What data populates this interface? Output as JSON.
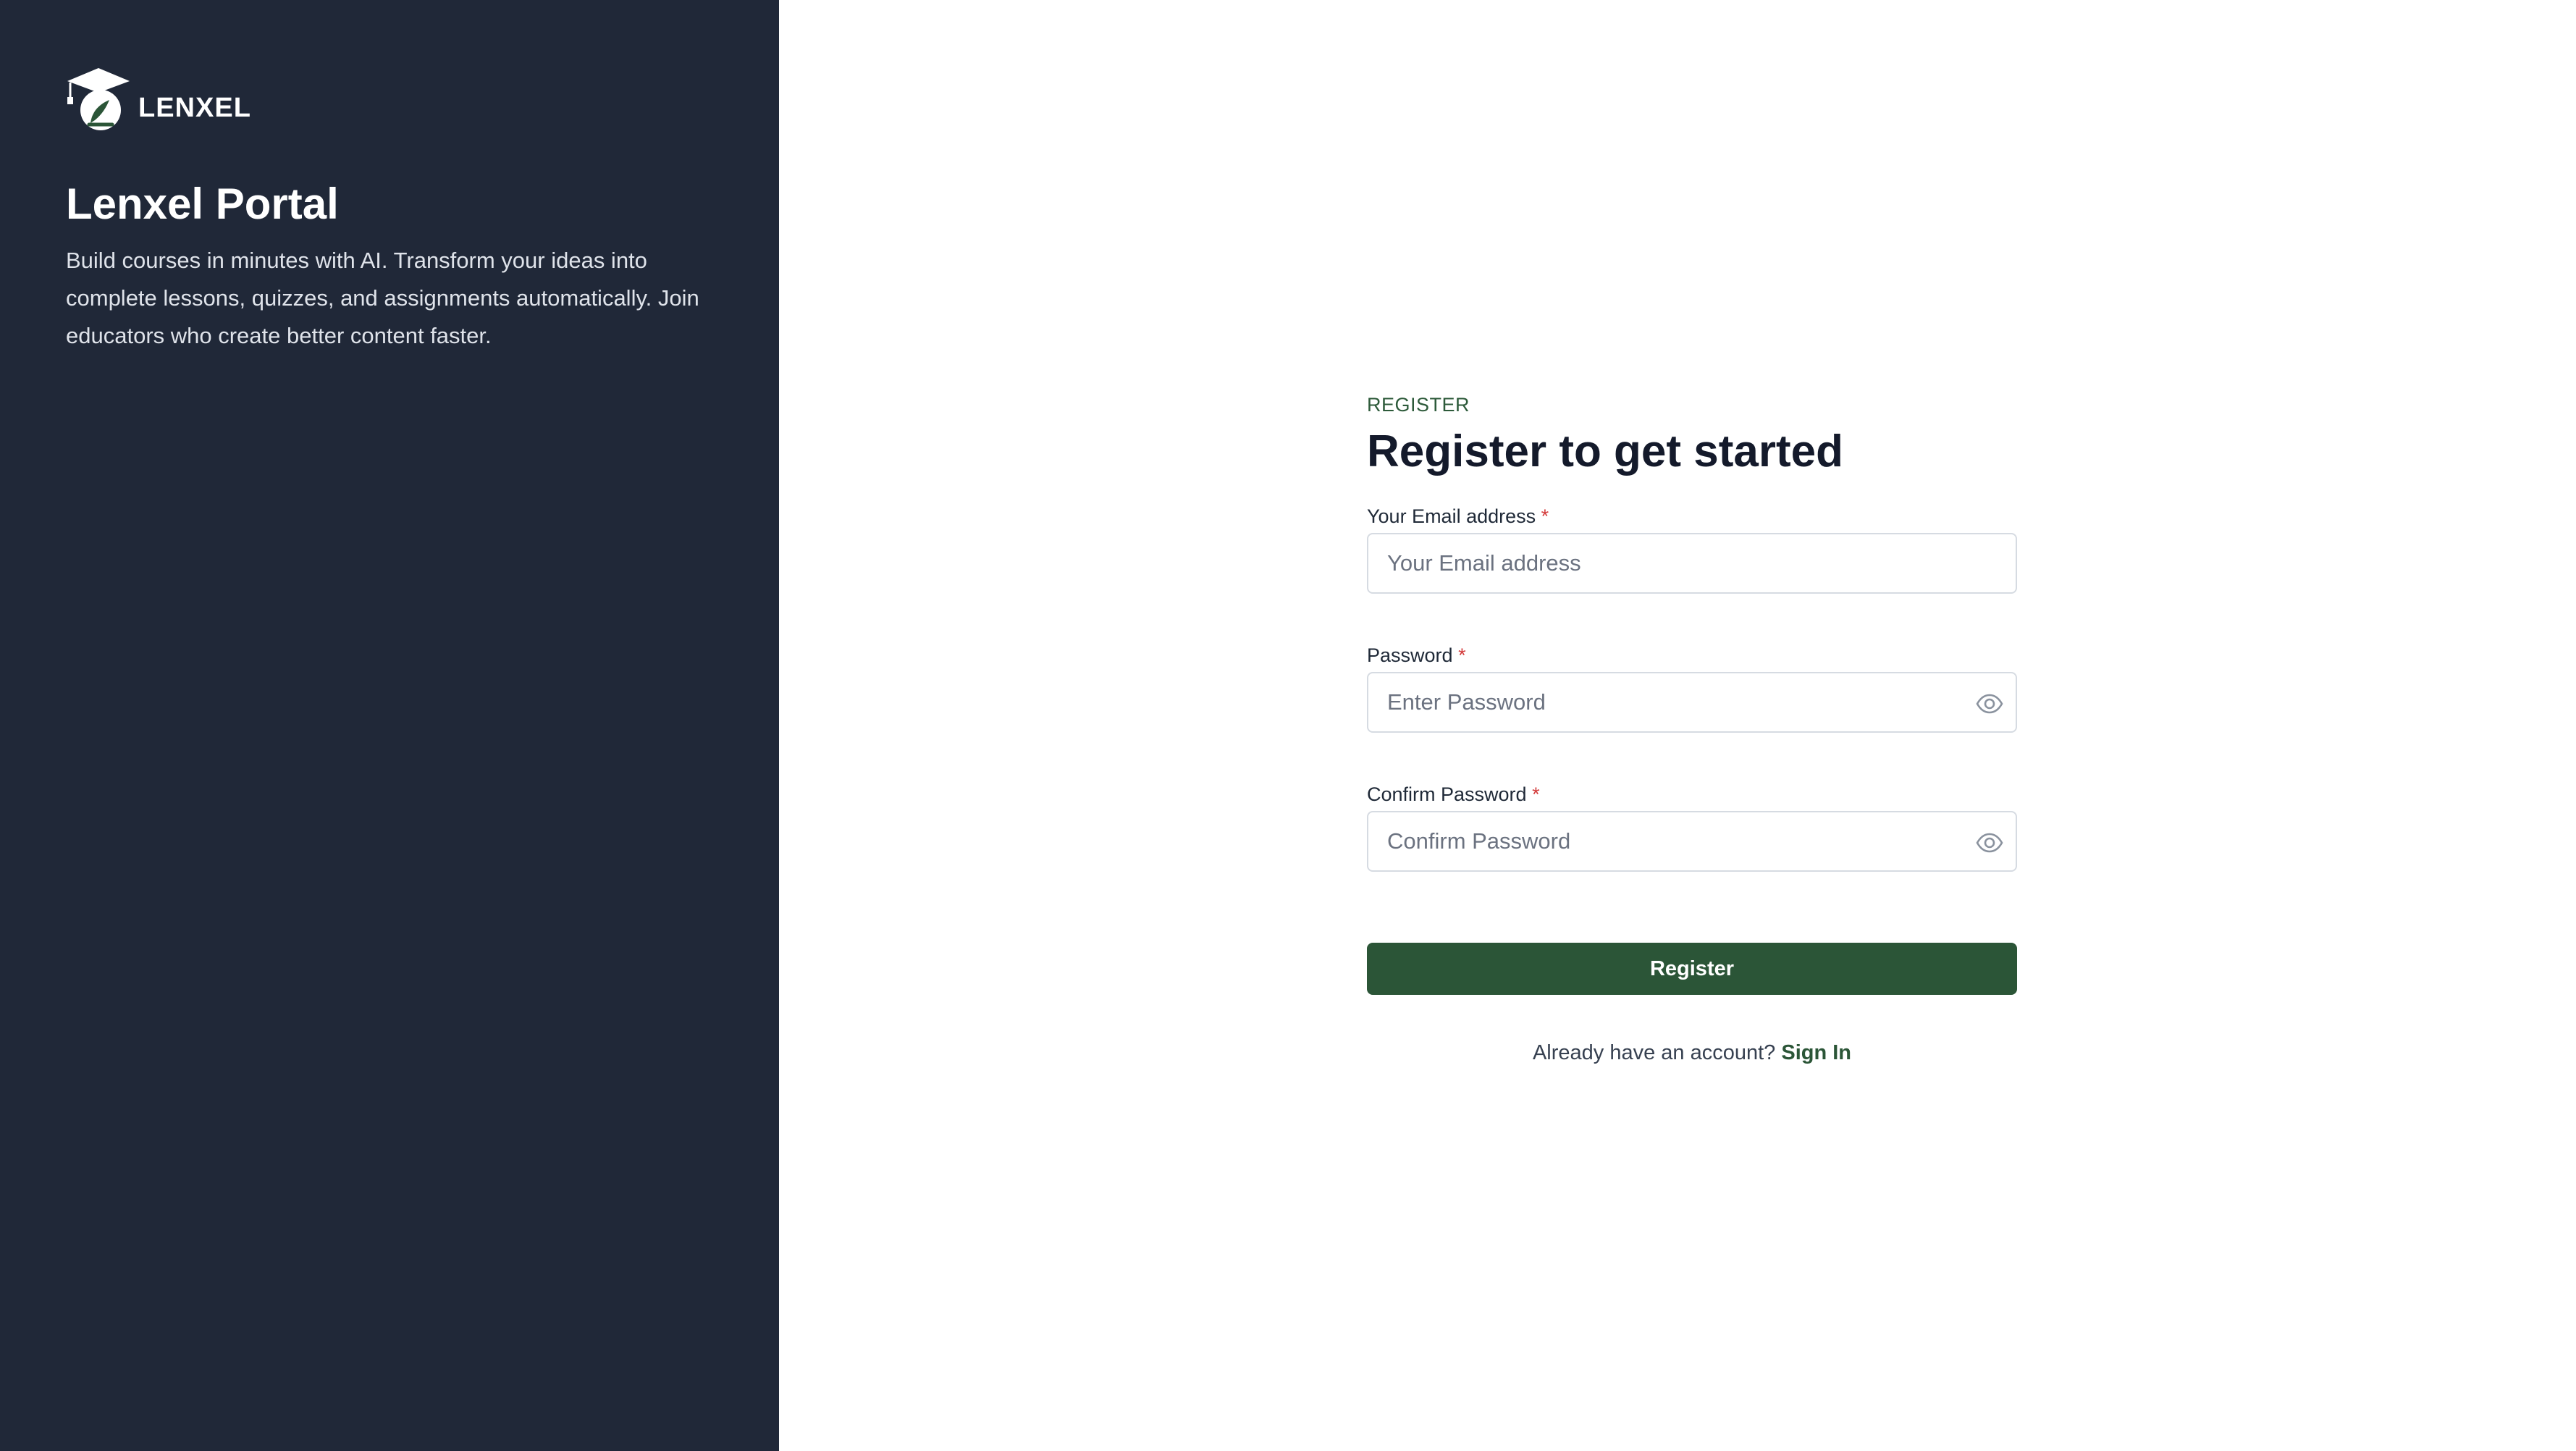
{
  "sidebar": {
    "brand_name": "LENXEL",
    "title": "Lenxel Portal",
    "description": "Build courses in minutes with AI. Transform your ideas into complete lessons, quizzes, and assignments automatically. Join educators who create better content faster."
  },
  "form": {
    "eyebrow": "REGISTER",
    "title": "Register to get started",
    "required_marker": "*",
    "email": {
      "label": "Your Email address",
      "placeholder": "Your Email address",
      "value": ""
    },
    "password": {
      "label": "Password",
      "placeholder": "Enter Password",
      "value": ""
    },
    "confirm_password": {
      "label": "Confirm Password",
      "placeholder": "Confirm Password",
      "value": ""
    },
    "submit_label": "Register",
    "signin_prompt": "Already have an account?",
    "signin_link": "Sign In"
  },
  "icons": {
    "logo": "graduation-cap-logo-icon",
    "password_toggle": "eye-icon",
    "confirm_toggle": "eye-icon"
  },
  "colors": {
    "sidebar_bg": "#202838",
    "accent_green": "#2b5537",
    "required_red": "#d33a3a",
    "title_dark": "#141a2b"
  }
}
